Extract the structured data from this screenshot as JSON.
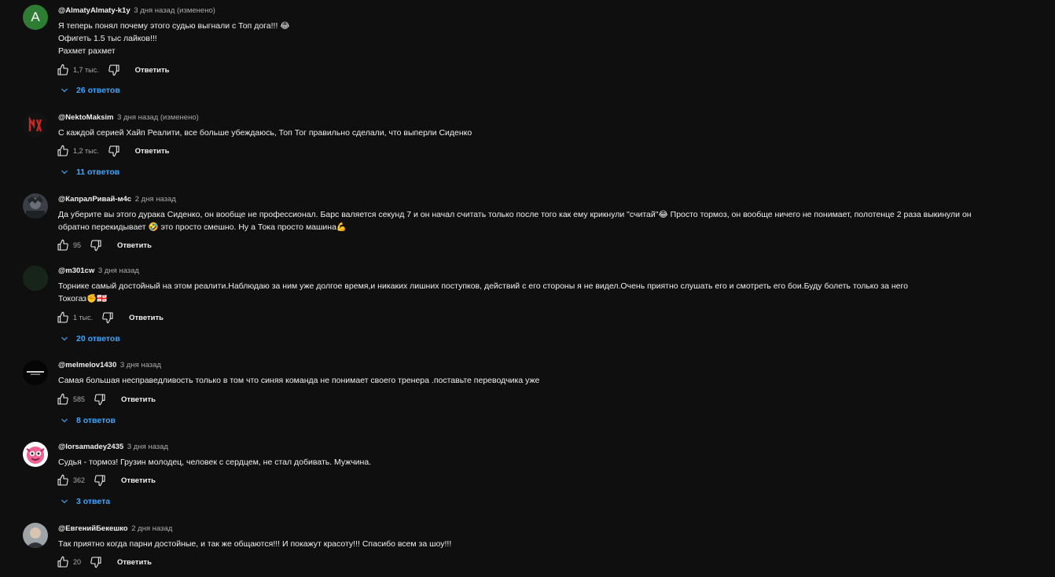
{
  "comments": [
    {
      "author": "@AlmatyAlmaty-k1y",
      "time": "3 дня назад (изменено)",
      "avatar_letter": "A",
      "lines": [
        "Я теперь понял почему этого судью выгнали с Топ дога!!! 😂",
        "Офигеть 1.5 тыс лайков!!!",
        "Рахмет рахмет"
      ],
      "likes": "1,7 тыс.",
      "reply_label": "Ответить",
      "replies": "26 ответов"
    },
    {
      "author": "@NektoMaksim",
      "time": "3 дня назад (изменено)",
      "lines": [
        "С каждой серией Хайп Реалити, все больше убеждаюсь,  Топ Тог правильно сделали, что выперли Сиденко"
      ],
      "likes": "1,2 тыс.",
      "reply_label": "Ответить",
      "replies": "11 ответов"
    },
    {
      "author": "@КапралРивай-м4с",
      "time": "2 дня назад",
      "lines": [
        "Да уберите вы этого дурака Сиденко, он вообще не профессионал. Барс валяется секунд 7 и он начал считать только после того как ему крикнули \"считай\"😂  Просто тормоз, он вообще ничего не понимает, полотенце 2 раза выкинули он",
        "обратно перекидывает 🤣  это просто смешно. Ну а Тока просто машина💪"
      ],
      "likes": "95",
      "reply_label": "Ответить"
    },
    {
      "author": "@m301cw",
      "time": "3 дня назад",
      "lines": [
        "Торнике самый достойный на этом реалити.Наблюдаю за ним уже долгое время,и никаких лишних поступков, действий с его стороны я не видел.Очень приятно слушать его и смотреть его бои.Буду болеть только за него",
        "Токогаз✊🇬🇪"
      ],
      "likes": "1 тыс.",
      "reply_label": "Ответить",
      "replies": "20 ответов"
    },
    {
      "author": "@melmelov1430",
      "time": "3 дня назад",
      "lines": [
        "Самая большая несправедливость только в том что синяя команда не понимает своего тренера .поставьте переводчика уже"
      ],
      "likes": "585",
      "reply_label": "Ответить",
      "replies": "8 ответов"
    },
    {
      "author": "@lorsamadey2435",
      "time": "3 дня назад",
      "lines": [
        "Судья - тормоз! Грузин молодец, человек с сердцем, не стал добивать. Мужчина."
      ],
      "likes": "362",
      "reply_label": "Ответить",
      "replies": "3 ответа"
    },
    {
      "author": "@ЕвгенийБекешко",
      "time": "2 дня назад",
      "lines": [
        "Так приятно когда парни достойные, и так же общаются!!! И покажут красоту!!! Спасибо всем за шоу!!!"
      ],
      "likes": "20",
      "reply_label": "Ответить"
    }
  ],
  "icons": {
    "like": "thumbs-up-icon",
    "dislike": "thumbs-down-icon",
    "expand": "chevron-down-icon"
  },
  "colors": {
    "background": "#0f0f0f",
    "text": "#f1f1f1",
    "secondary": "#aaaaaa",
    "link": "#3ea6ff"
  }
}
